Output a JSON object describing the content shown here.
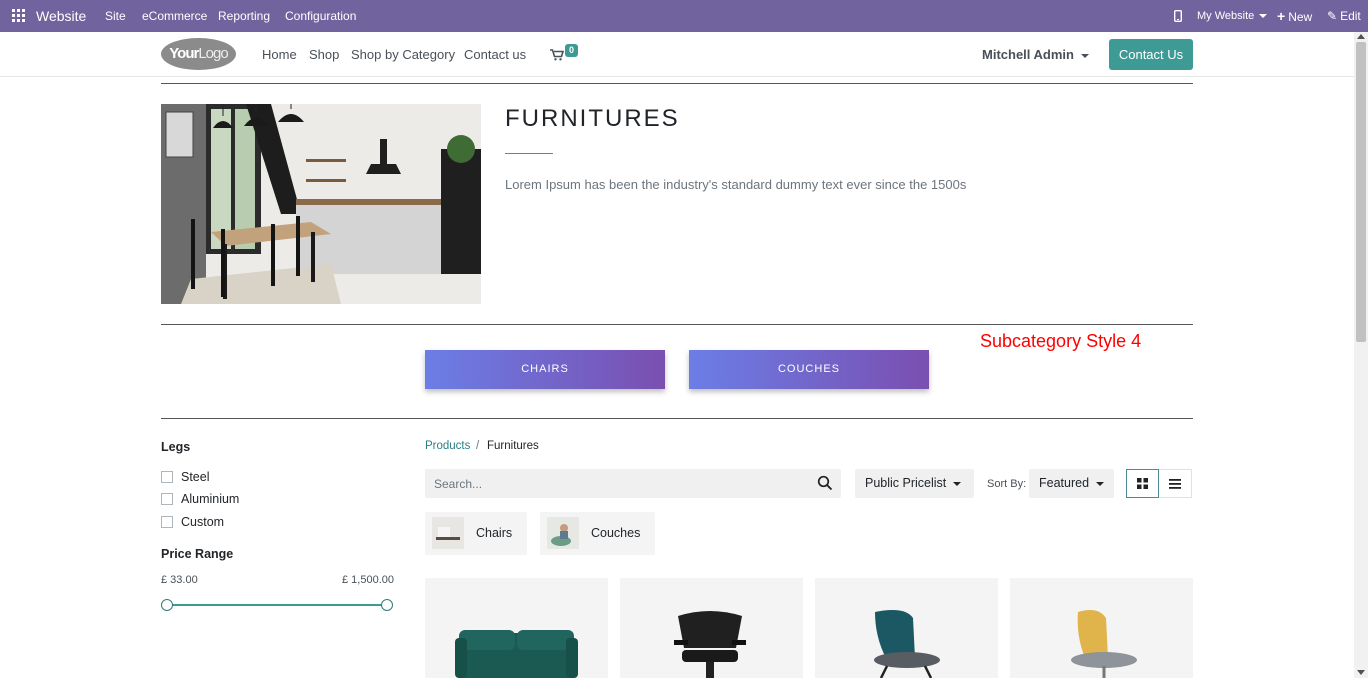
{
  "topbar": {
    "app_name": "Website",
    "menu": [
      "Site",
      "eCommerce",
      "Reporting",
      "Configuration"
    ],
    "my_website": "My Website",
    "new_label": "New",
    "edit_label": "Edit",
    "bg_color": "#71639e"
  },
  "nav": {
    "logo_bold": "Your",
    "logo_light": "Logo",
    "links": [
      "Home",
      "Shop",
      "Shop by Category",
      "Contact us"
    ],
    "cart_count": "0",
    "user": "Mitchell Admin",
    "contact_button": "Contact Us",
    "accent_color": "#3d9a95"
  },
  "hero": {
    "title": "FURNITURES",
    "description": "Lorem Ipsum has been the industry's standard dummy text ever since the 1500s"
  },
  "subcategory_note": "Subcategory Style 4",
  "subcategories": [
    "CHAIRS",
    "COUCHES"
  ],
  "sidebar": {
    "legs_title": "Legs",
    "legs_options": [
      "Steel",
      "Aluminium",
      "Custom"
    ],
    "price_title": "Price Range",
    "price_min": "£ 33.00",
    "price_max": "£ 1,500.00"
  },
  "breadcrumb": {
    "root": "Products",
    "separator": "/",
    "current": "Furnitures"
  },
  "toolbar": {
    "search_placeholder": "Search...",
    "pricelist": "Public Pricelist",
    "sort_label": "Sort By:",
    "sort_value": "Featured"
  },
  "category_chips": [
    "Chairs",
    "Couches"
  ],
  "products_visible": 4
}
